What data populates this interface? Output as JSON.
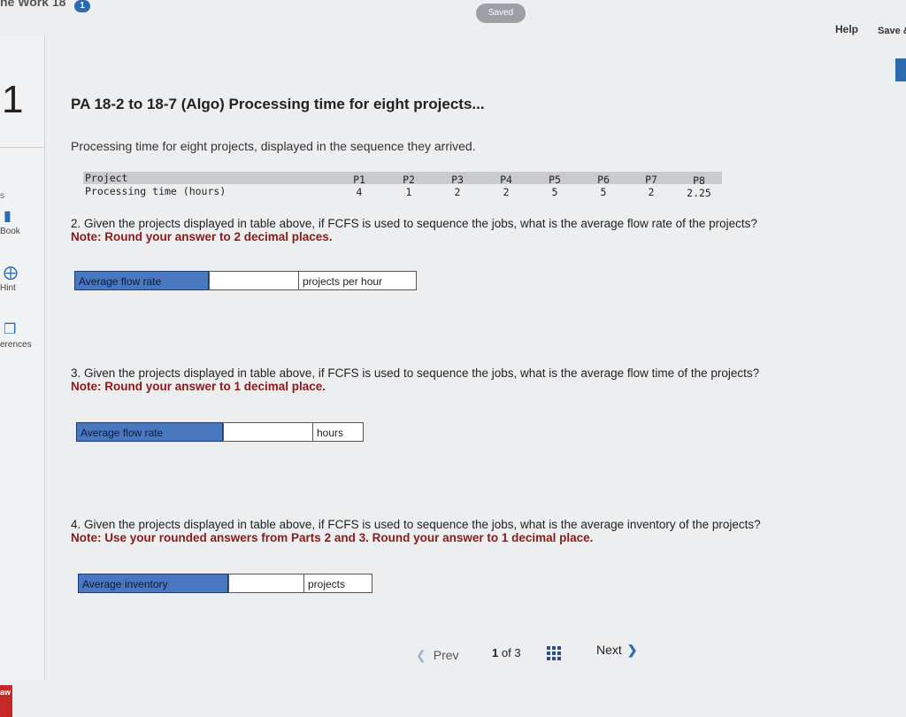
{
  "header": {
    "assignment_title": "ne Work 18",
    "badge": "1",
    "saved_label": "Saved",
    "help_label": "Help",
    "save_exit_label": "Save &"
  },
  "sidebar": {
    "question_number": "1",
    "points": "s",
    "items": [
      {
        "label": "Book",
        "icon": "book-icon"
      },
      {
        "label": "Hint",
        "icon": "hint-icon"
      },
      {
        "label": "erences",
        "icon": "references-icon"
      }
    ],
    "logo": "aw"
  },
  "problem": {
    "title": "PA 18-2 to 18-7 (Algo) Processing time for eight projects...",
    "intro": "Processing time for eight projects, displayed in the sequence they arrived.",
    "table": {
      "row1_label": "Project",
      "row2_label": "Processing time (hours)",
      "projects": [
        "P1",
        "P2",
        "P3",
        "P4",
        "P5",
        "P6",
        "P7",
        "P8"
      ],
      "times": [
        "4",
        "1",
        "2",
        "2",
        "5",
        "5",
        "2",
        "2.25"
      ]
    }
  },
  "q2": {
    "question": "2. Given the projects displayed in table above, if FCFS is used to sequence the jobs, what is the average flow rate of the projects?",
    "note": "Note: Round your answer to 2 decimal places.",
    "answer_label": "Average flow rate",
    "answer_value": "",
    "unit": "projects per hour"
  },
  "q3": {
    "question": "3. Given the projects displayed in table above, if FCFS is used to sequence the jobs, what is the average flow time of the projects?",
    "note": "Note: Round your answer to 1 decimal place.",
    "answer_label": "Average flow rate",
    "answer_value": "",
    "unit": "hours"
  },
  "q4": {
    "question": "4. Given the projects displayed in table above, if FCFS is used to sequence the jobs, what is the average inventory of the projects?",
    "note": "Note: Use your rounded answers from Parts 2 and 3. Round your answer to 1 decimal place.",
    "answer_label": "Average inventory",
    "answer_value": "",
    "unit": "projects"
  },
  "pager": {
    "prev_label": "Prev",
    "current": "1",
    "of_label": "of",
    "total": "3",
    "next_label": "Next"
  }
}
